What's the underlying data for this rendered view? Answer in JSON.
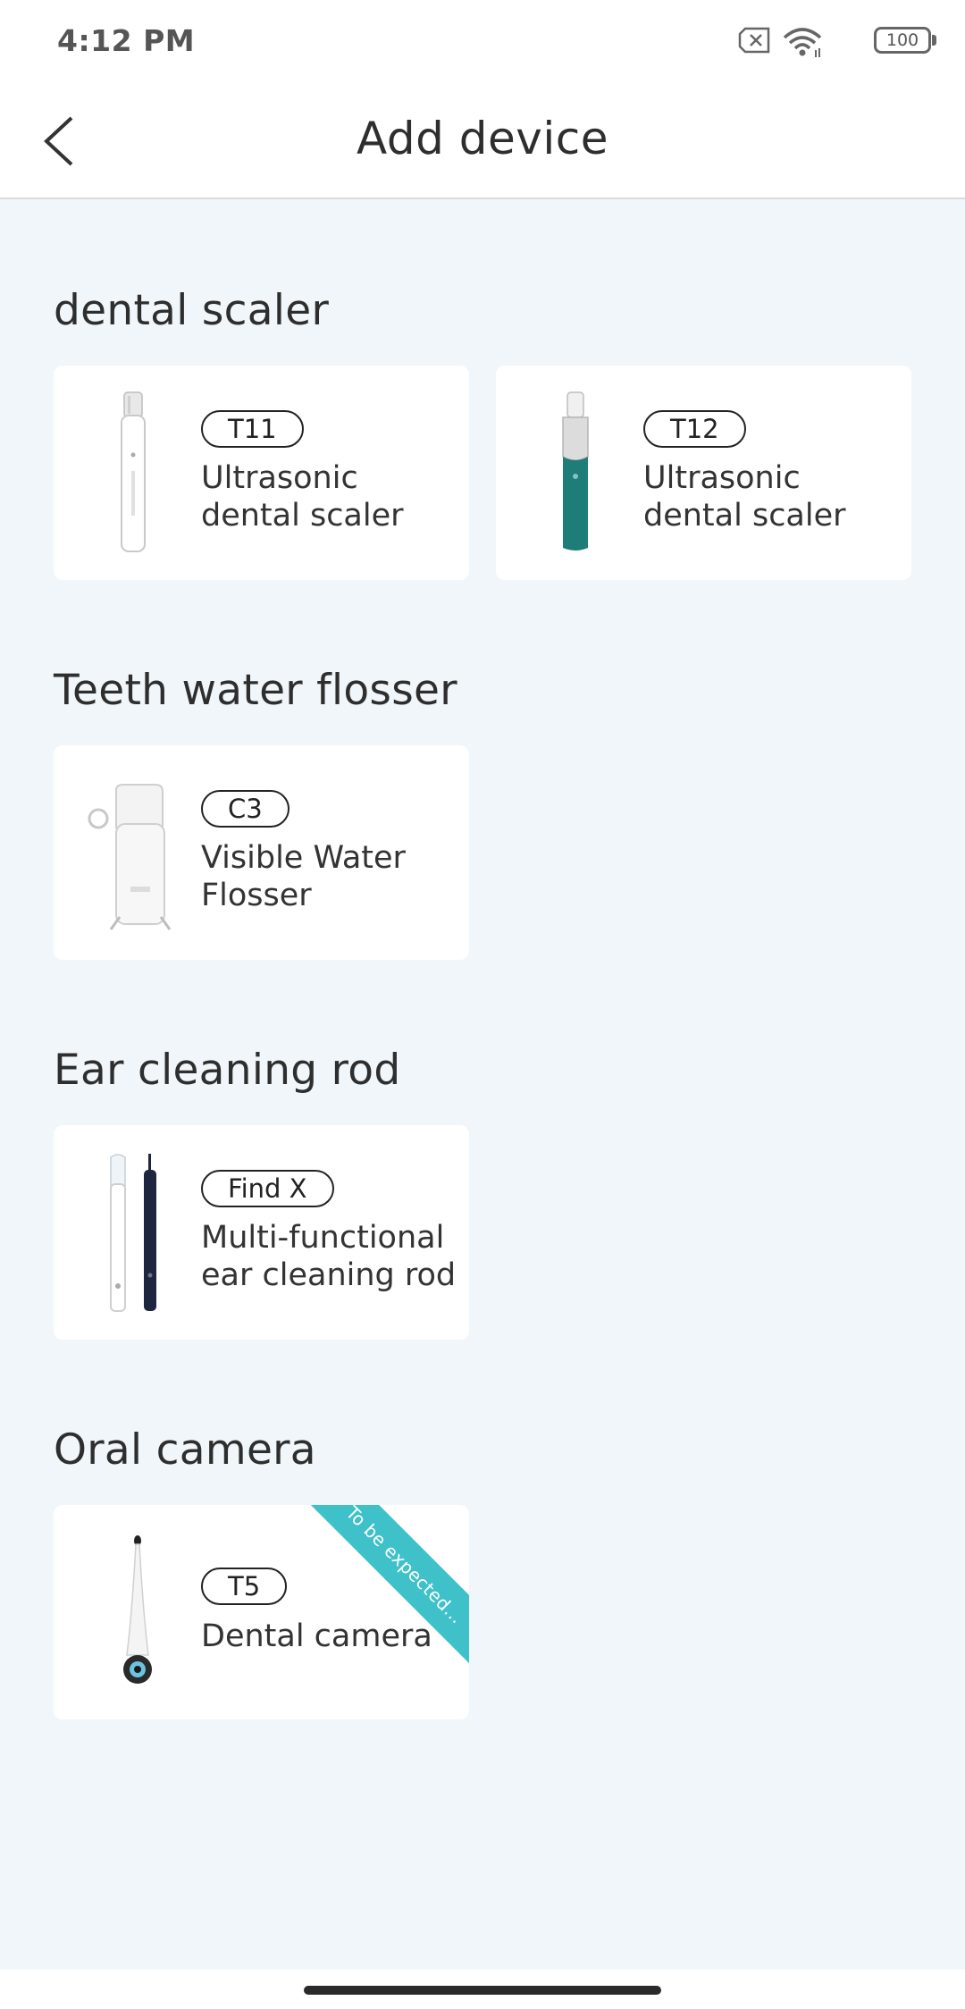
{
  "status_bar": {
    "time": "4:12 PM",
    "battery": "100",
    "icons": [
      "no-sim-icon",
      "wifi-icon",
      "battery-icon"
    ]
  },
  "header": {
    "title": "Add device",
    "back_icon": "chevron-left-icon"
  },
  "sections": [
    {
      "title": "dental scaler",
      "devices": [
        {
          "model": "T11",
          "name": "Ultrasonic dental scaler",
          "image": "white-scaler-image"
        },
        {
          "model": "T12",
          "name": "Ultrasonic dental scaler",
          "image": "green-scaler-image"
        }
      ]
    },
    {
      "title": "Teeth water flosser",
      "devices": [
        {
          "model": "C3",
          "name": "Visible Water Flosser",
          "image": "water-flosser-image"
        }
      ]
    },
    {
      "title": "Ear cleaning rod",
      "devices": [
        {
          "model": "Find X",
          "name": "Multi-functional ear cleaning rod",
          "image": "ear-rod-image"
        }
      ]
    },
    {
      "title": "Oral camera",
      "devices": [
        {
          "model": "T5",
          "name": "Dental camera",
          "image": "dental-camera-image",
          "ribbon": "To be expected..."
        }
      ]
    }
  ],
  "colors": {
    "background": "#f0f6f9",
    "card": "#ffffff",
    "ribbon": "#3ec1c9",
    "scaler_green": "#1e7d76"
  }
}
